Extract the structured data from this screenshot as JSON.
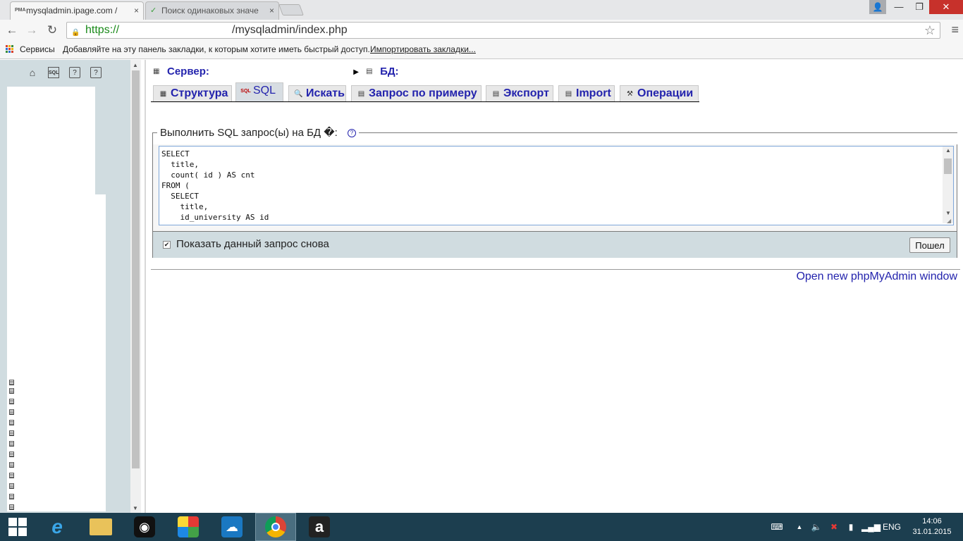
{
  "browser": {
    "tabs": [
      {
        "title": "mysqladmin.ipage.com /",
        "favicon": "PMA",
        "active": true
      },
      {
        "title": "Поиск одинаковых значе",
        "favicon": "leaf-icon",
        "active": false
      }
    ],
    "close_glyph": "×",
    "window_controls": {
      "user": "👤",
      "minimize": "—",
      "maximize": "❐",
      "close": "✕"
    },
    "address": {
      "scheme": "https://",
      "path": "/mysqladmin/index.php"
    },
    "bookmarks": {
      "apps_label": "Сервисы",
      "hint": "Добавляйте на эту панель закладки, к которым хотите иметь быстрый доступ.",
      "import_link": "Импортировать закладки..."
    }
  },
  "pma": {
    "breadcrumb": {
      "server_label": "Сервер:",
      "db_label": "БД:"
    },
    "tabs": [
      {
        "label": "Структура",
        "icon": "structure-icon"
      },
      {
        "label": "SQL",
        "icon": "sql-icon",
        "active": true
      },
      {
        "label": "Искать",
        "icon": "search-icon"
      },
      {
        "label": "Запрос по примеру",
        "icon": "query-icon"
      },
      {
        "label": "Экспорт",
        "icon": "export-icon"
      },
      {
        "label": "Import",
        "icon": "import-icon"
      },
      {
        "label": "Операции",
        "icon": "operations-icon"
      }
    ],
    "sql_form": {
      "legend": "Выполнить SQL запрос(ы) на БД �:",
      "help_glyph": "?",
      "query": "SELECT\n  title,\n  count( id ) AS cnt\nFROM (\n  SELECT\n    title,\n    id_university AS id",
      "show_again_label": "Показать данный запрос снова",
      "show_again_checked": true,
      "go_label": "Пошел"
    },
    "new_window_link": "Open new phpMyAdmin window"
  },
  "taskbar": {
    "language": "ENG",
    "time": "14:06",
    "date": "31.01.2015"
  }
}
